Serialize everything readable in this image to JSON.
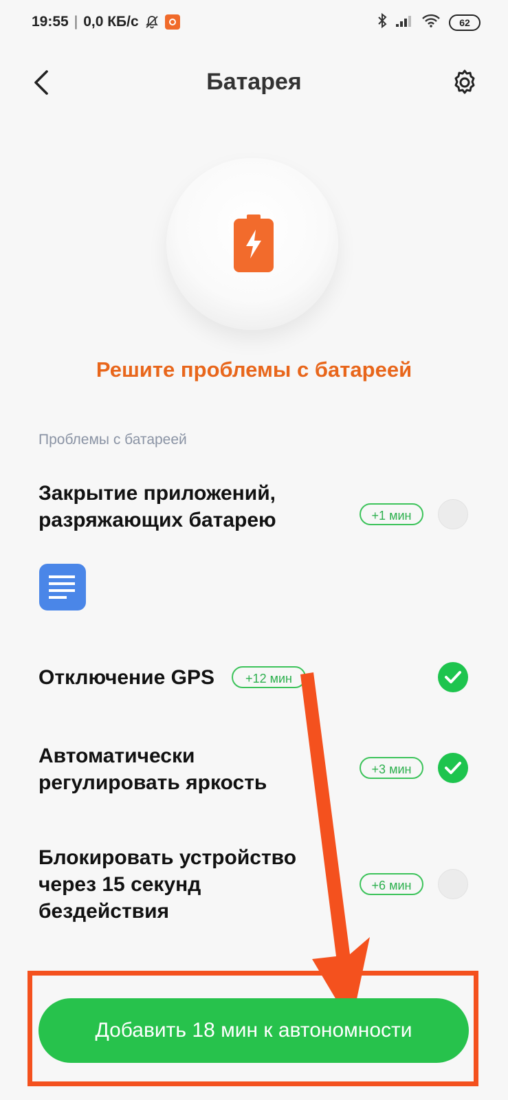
{
  "status_bar": {
    "time": "19:55",
    "network_speed": "0,0 КБ/с",
    "battery_level": "62",
    "icons": [
      "mute-icon",
      "app-notification-icon",
      "bluetooth-icon",
      "signal-icon",
      "wifi-icon",
      "battery-icon"
    ]
  },
  "header": {
    "title": "Батарея",
    "back_icon": "chevron-left-icon",
    "settings_icon": "gear-icon"
  },
  "hero": {
    "icon": "battery-charging-icon",
    "icon_color": "#f26b2c",
    "title": "Решите проблемы с батареей",
    "title_color": "#e8661b"
  },
  "issues": {
    "section_label": "Проблемы с батареей",
    "items": [
      {
        "title_line1": "Закрытие приложений,",
        "title_line2": "разряжающих батарею",
        "badge": "+1 мин",
        "checked": false,
        "app_icon": "docs-app-icon"
      },
      {
        "title_line1": "Отключение GPS",
        "badge": "+12 мин",
        "checked": true
      },
      {
        "title_line1": "Автоматически",
        "title_line2": "регулировать яркость",
        "badge": "+3 мин",
        "checked": true
      },
      {
        "title_line1": "Блокировать устройство",
        "title_line2": "через 15 секунд",
        "title_line3": "бездействия",
        "badge": "+6 мин",
        "checked": false
      }
    ]
  },
  "action": {
    "button_label": "Добавить 18 мин к автономности",
    "button_color": "#27c24c",
    "highlight_color": "#f4511e"
  }
}
